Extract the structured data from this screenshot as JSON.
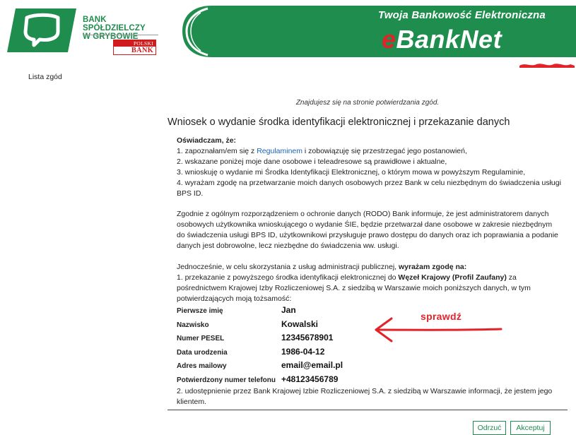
{
  "header": {
    "bank_name_line1": "BANK SPÓŁDZIELCZY",
    "bank_name_line2": "W GRYBOWIE",
    "polski_bank_top": "POLSKI",
    "polski_bank_bottom": "BANK",
    "banner_tagline": "Twoja Bankowość Elektroniczna",
    "brand_e": "e",
    "brand_rest": "BankNet",
    "brand_color": "#1e8d4d",
    "accent_red": "#e3232a"
  },
  "sidebar": {
    "items": [
      {
        "label": "Lista zgód"
      }
    ]
  },
  "main": {
    "location_text": "Znajdujesz się na stronie potwierdzania zgód.",
    "title": "Wniosek o wydanie środka identyfikacji elektronicznej i przekazanie danych",
    "declaration_heading": "Oświadczam, że:",
    "declaration_1_pre": "1. zapoznałam/em się z ",
    "declaration_1_link": "Regulaminem",
    "declaration_1_post": " i zobowiązuję się przestrzegać jego postanowień,",
    "declaration_2": "2. wskazane poniżej moje dane osobowe i teleadresowe są prawidłowe i aktualne,",
    "declaration_3": "3. wnioskuję o wydanie mi Środka Identyfikacji Elektronicznej, o którym mowa w powyższym Regulaminie,",
    "declaration_4": "4. wyrażam zgodę na przetwarzanie moich danych osobowych przez Bank w celu niezbędnym do świadczenia usługi BPS ID.",
    "rodo_text": "Zgodnie z ogólnym rozporządzeniem o ochronie danych (RODO) Bank informuje, że jest administratorem danych osobowych użytkownika wnioskującego o wydanie ŚIE, będzie przetwarzał dane osobowe w zakresie niezbędnym do świadczenia usługi BPS ID, użytkownikowi przysługuje prawo dostępu do danych oraz ich poprawiania a podanie danych jest dobrowolne, lecz niezbędne do świadczenia ww. usługi.",
    "consent_intro_pre": "Jednocześnie, w celu skorzystania z usług administracji publicznej, ",
    "consent_intro_bold": "wyrażam zgodę na:",
    "consent_1_pre": "1. przekazanie z powyższego środka identyfikacji elektronicznej do ",
    "consent_1_bold": "Węzeł Krajowy (Profil Zaufany)",
    "consent_1_post": " za pośrednictwem Krajowej Izby Rozliczeniowej S.A. z siedzibą w Warszawie moich poniższych danych, w tym potwierdzających moją tożsamość:",
    "fields": [
      {
        "label": "Pierwsze imię",
        "value": "Jan"
      },
      {
        "label": "Nazwisko",
        "value": "Kowalski"
      },
      {
        "label": "Numer PESEL",
        "value": "12345678901"
      },
      {
        "label": "Data urodzenia",
        "value": "1986-04-12"
      },
      {
        "label": "Adres mailowy",
        "value": "email@email.pl"
      },
      {
        "label": "Potwierdzony numer telefonu",
        "value": "+48123456789"
      }
    ],
    "annotation": "sprawdź",
    "consent_2": "2. udostępnienie przez Bank Krajowej Izbie Rozliczeniowej S.A. z siedzibą w Warszawie informacji, że jestem jego klientem."
  },
  "actions": {
    "reject_label": "Odrzuć",
    "accept_label": "Akceptuj"
  }
}
